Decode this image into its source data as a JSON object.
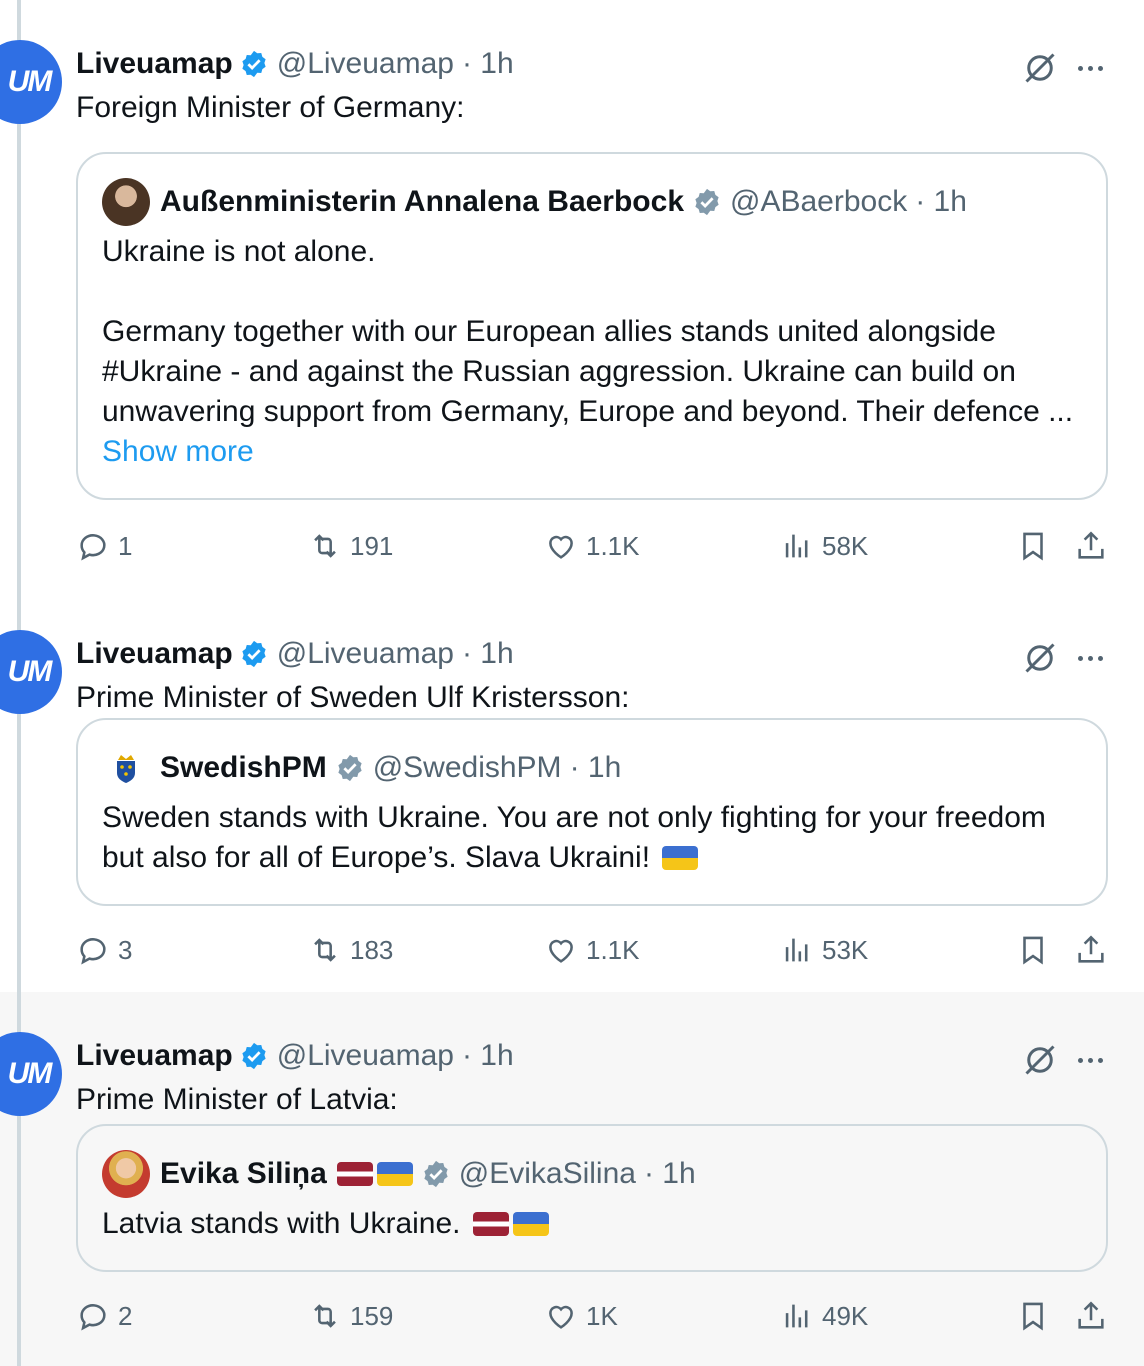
{
  "tweets": [
    {
      "author": "Liveuamap",
      "handle": "@Liveuamap",
      "time": "· 1h",
      "text": "Foreign Minister of Germany:",
      "avatar_text": "UM",
      "quote": {
        "author": "Außenministerin Annalena Baerbock",
        "handle": "@ABaerbock",
        "time": "· 1h",
        "lines": [
          "Ukraine is not alone.",
          "",
          "Germany together with our European allies stands united alongside",
          "#Ukraine - and against the Russian aggression. Ukraine can build on",
          "unwavering support from Germany, Europe and beyond. Their defence ..."
        ],
        "show_more": "Show more"
      },
      "stats": {
        "replies": "1",
        "reposts": "191",
        "likes": "1.1K",
        "views": "58K"
      }
    },
    {
      "author": "Liveuamap",
      "handle": "@Liveuamap",
      "time": "· 1h",
      "text": "Prime Minister of Sweden Ulf Kristersson:",
      "avatar_text": "UM",
      "quote": {
        "author": "SwedishPM",
        "handle": "@SwedishPM",
        "time": "· 1h",
        "lines": [
          "Sweden stands with Ukraine. You are not only fighting for your freedom",
          "but also for all of Europe’s. Slava Ukraini!"
        ]
      },
      "stats": {
        "replies": "3",
        "reposts": "183",
        "likes": "1.1K",
        "views": "53K"
      }
    },
    {
      "author": "Liveuamap",
      "handle": "@Liveuamap",
      "time": "· 1h",
      "text": "Prime Minister of Latvia:",
      "avatar_text": "UM",
      "quote": {
        "author": "Evika Siliņa",
        "handle": "@EvikaSilina",
        "time": "· 1h",
        "lines": [
          "Latvia stands with Ukraine."
        ]
      },
      "stats": {
        "replies": "2",
        "reposts": "159",
        "likes": "1K",
        "views": "49K"
      }
    }
  ],
  "colors": {
    "accent": "#1d9bf0",
    "muted": "#536471",
    "border": "#cfd9de",
    "avatar": "#2f6fe4",
    "verified": "#1d9bf0",
    "gov_verified": "#829aab"
  },
  "icons": [
    "verified-badge-icon",
    "grok-icon",
    "more-icon",
    "reply-icon",
    "repost-icon",
    "like-icon",
    "views-icon",
    "bookmark-icon",
    "share-icon",
    "flag-ukraine-icon",
    "flag-latvia-icon"
  ]
}
